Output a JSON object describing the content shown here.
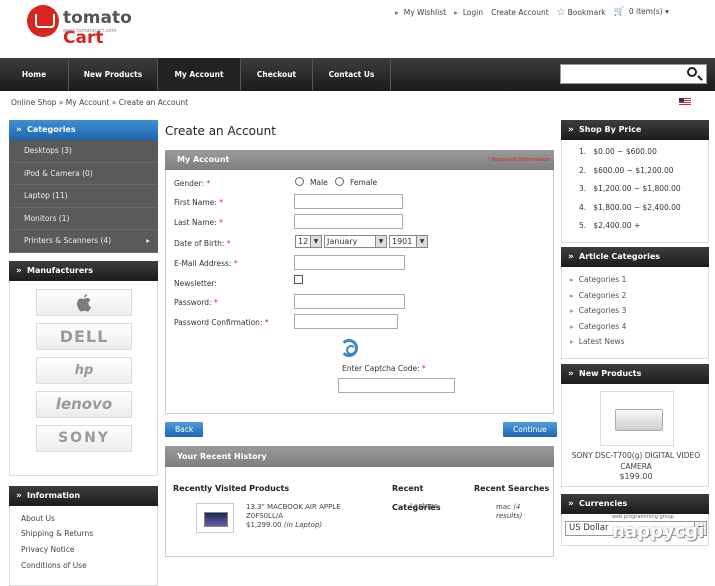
{
  "header": {
    "logo_text_a": "tomato",
    "logo_text_b": "Cart",
    "logo_url": "www.tomatocart.com",
    "links": [
      "My Wishlist",
      "Login",
      "Create Account"
    ],
    "bookmark": "Bookmark",
    "cart": "0 item(s)"
  },
  "nav": {
    "items": [
      "Home",
      "New Products",
      "My Account",
      "Checkout",
      "Contact Us"
    ]
  },
  "breadcrumb": "Online Shop » My Account » Create an Account",
  "left": {
    "categories_title": "Categories",
    "categories": [
      "Desktops (3)",
      "iPod & Camera (0)",
      "Laptop (11)",
      "Monitors (1)",
      "Printers & Scanners (4)"
    ],
    "manufacturers_title": "Manufacturers",
    "manufacturers": [
      "",
      "DELL",
      "hp",
      "lenovo",
      "SONY"
    ],
    "information_title": "Information",
    "information": [
      "About Us",
      "Shipping & Returns",
      "Privacy Notice",
      "Conditions of Use"
    ]
  },
  "form": {
    "page_title": "Create an Account",
    "section_title": "My Account",
    "required_note": "* Required information",
    "gender_label": "Gender:",
    "male": "Male",
    "female": "Female",
    "first_name_label": "First Name:",
    "last_name_label": "Last Name:",
    "dob_label": "Date of Birth:",
    "dob_day": "12",
    "dob_month": "January",
    "dob_year": "1901",
    "email_label": "E-Mail Address:",
    "newsletter_label": "Newsletter:",
    "password_label": "Password:",
    "password_confirm_label": "Password Confirmation:",
    "captcha_label": "Enter Captcha Code:",
    "star": "*"
  },
  "buttons": {
    "back": "Back",
    "continue": "Continue"
  },
  "history": {
    "title": "Your Recent History",
    "visited_title": "Recently Visited Products",
    "recent_title_a": "Recent",
    "recent_title_b": "Categories",
    "recent_overlap": "Laptops",
    "searches_title": "Recent Searches",
    "product_name_a": "13.3\" MACBOOK AIR APPLE",
    "product_name_b": "Z0FS0LL/A",
    "product_price": "$1,299.00",
    "product_category": "(in Laptop)",
    "search_term": "mac",
    "search_results_a": "(4",
    "search_results_b": "results)"
  },
  "right": {
    "price_title": "Shop By Price",
    "prices": [
      "$0.00 ~ $600.00",
      "$600.00 ~ $1,200.00",
      "$1,200.00 ~ $1,800.00",
      "$1,800.00 ~ $2,400.00",
      "$2,400.00 +"
    ],
    "price_nums": [
      "1.",
      "2.",
      "3.",
      "4.",
      "5."
    ],
    "articles_title": "Article Categories",
    "articles": [
      "Categories 1",
      "Categories 2",
      "Categories 3",
      "Categories 4",
      "Latest News"
    ],
    "new_products_title": "New Products",
    "new_product_name": "SONY DSC-T700(g) DIGITAL VIDEO CAMERA",
    "new_product_price": "$199.00",
    "currencies_title": "Currencies",
    "currency": "US Dollar"
  },
  "watermark": {
    "text": "nappycgi",
    "sub": "web programming group"
  }
}
